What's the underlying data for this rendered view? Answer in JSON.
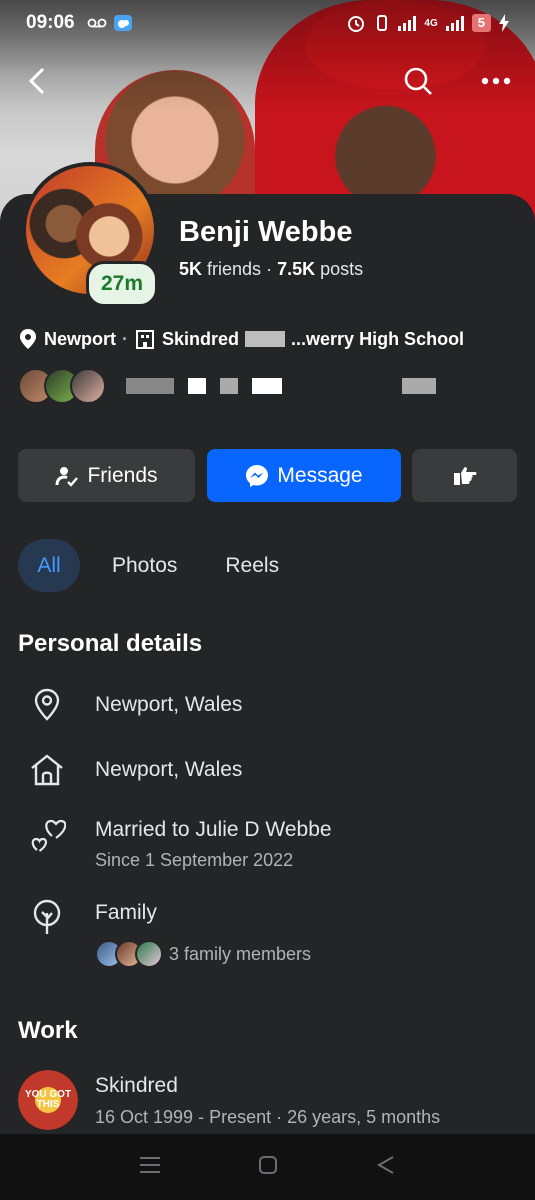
{
  "status_bar": {
    "time": "09:06",
    "network": "4G",
    "battery": "5"
  },
  "profile": {
    "name": "Benji Webbe",
    "friends_count": "5K",
    "friends_label": "friends",
    "separator": "·",
    "posts_count": "7.5K",
    "posts_label": "posts",
    "active_badge": "27m",
    "info_location": "Newport",
    "info_work": "Skindred",
    "info_school": "...werry High School"
  },
  "actions": {
    "friends_label": "Friends",
    "message_label": "Message"
  },
  "tabs": [
    {
      "label": "All"
    },
    {
      "label": "Photos"
    },
    {
      "label": "Reels"
    }
  ],
  "personal_details": {
    "title": "Personal details",
    "current_city": "Newport, Wales",
    "hometown": "Newport, Wales",
    "relationship": "Married to Julie D Webbe",
    "relationship_since": "Since 1 September 2022",
    "family_title": "Family",
    "family_members": "3 family members"
  },
  "work": {
    "title": "Work",
    "employer": "Skindred",
    "dates": "16 Oct 1999 - Present · 26 years, 5 months",
    "logo_text": "YOU GOT THIS"
  },
  "colors": {
    "accent": "#0866ff",
    "background": "#242526",
    "active_badge_bg": "#e6f4e6",
    "active_badge_text": "#1b7a2b"
  }
}
